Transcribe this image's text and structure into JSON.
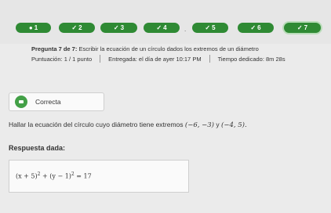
{
  "nav": {
    "items": [
      {
        "label": "1"
      },
      {
        "label": "2"
      },
      {
        "label": "3"
      },
      {
        "label": "4"
      },
      {
        "label": "5"
      },
      {
        "label": "6"
      },
      {
        "label": "7"
      }
    ],
    "separator": "."
  },
  "question": {
    "title_prefix": "Pregunta 7 de 7:",
    "title_text": "Escribir la ecuación de un círculo dados los extremos de un diámetro",
    "score": "Puntuación: 1 / 1 punto",
    "delivered": "Entregada: el día de ayer 10:17 PM",
    "time_spent": "Tiempo dedicado: 8m 28s"
  },
  "result": {
    "label": "Correcta",
    "color": "#43a047"
  },
  "statement": {
    "text": "Hallar la ecuación del círculo cuyo diámetro tiene extremos",
    "point_a": "(−6, −3)",
    "conj": "y",
    "point_b": "(−4, 5)."
  },
  "answer": {
    "label": "Respuesta dada:",
    "eq_part1": "(x + 5)",
    "exp1": "2",
    "eq_part2": " + (y − 1)",
    "exp2": "2",
    "eq_part3": " = 17"
  },
  "colors": {
    "accent": "#2f8a34"
  }
}
